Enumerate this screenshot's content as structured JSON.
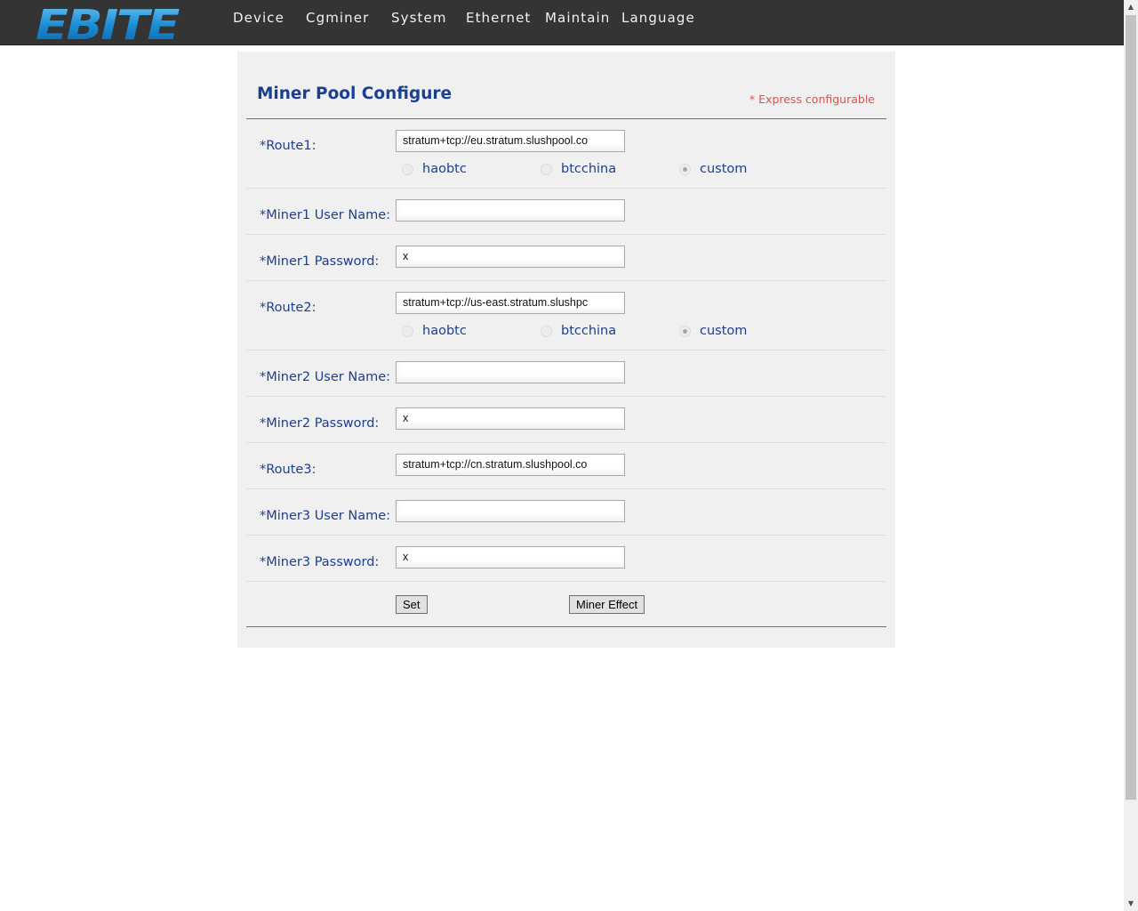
{
  "header": {
    "logo_text": "EBITE",
    "nav": [
      "Device",
      "Cgminer",
      "System",
      "Ethernet",
      "Maintain",
      "Language"
    ]
  },
  "panel": {
    "title": "Miner Pool Configure",
    "express_note": "* Express configurable"
  },
  "routes": [
    {
      "route_label": "*Route1:",
      "url": "stratum+tcp://eu.stratum.slushpool.co",
      "user_label": "*Miner1 User Name:",
      "user_value": "",
      "pass_label": "*Miner1 Password:",
      "pass_value": "x"
    },
    {
      "route_label": "*Route2:",
      "url": "stratum+tcp://us-east.stratum.slushpc",
      "user_label": "*Miner2 User Name:",
      "user_value": "",
      "pass_label": "*Miner2 Password:",
      "pass_value": "x"
    },
    {
      "route_label": "*Route3:",
      "url": "stratum+tcp://cn.stratum.slushpool.co",
      "user_label": "*Miner3 User Name:",
      "user_value": "",
      "pass_label": "*Miner3 Password:",
      "pass_value": "x"
    }
  ],
  "pool_options": {
    "haobtc": "haobtc",
    "btcchina": "btcchina",
    "custom": "custom",
    "selected": "custom"
  },
  "buttons": {
    "set": "Set",
    "miner_effect": "Miner Effect"
  },
  "colors": {
    "header_bg": "#343434",
    "panel_bg": "#f0f0f0",
    "label_blue": "#1b3f91",
    "note_red": "#d9534f"
  }
}
